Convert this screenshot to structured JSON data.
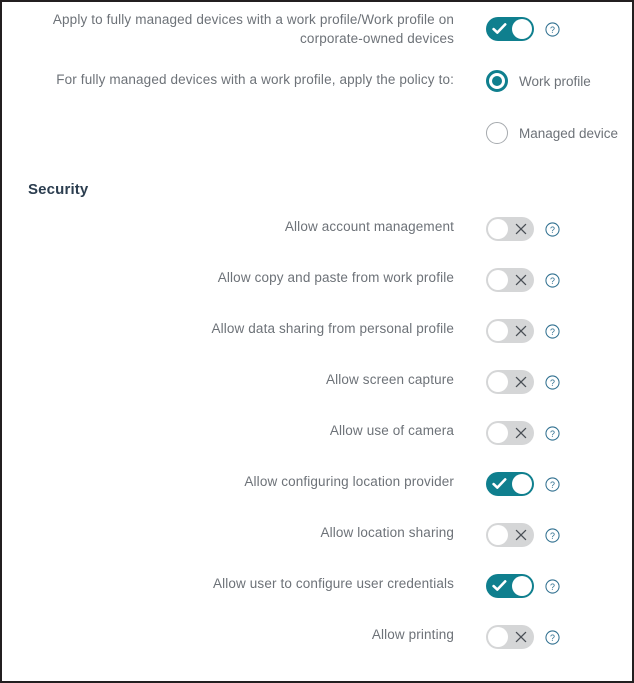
{
  "colors": {
    "accent": "#0f7f8e",
    "toggle_off_track": "#d5d6d7",
    "label_text": "#6d7278",
    "heading_text": "#2b3d4f",
    "border": "#231f20",
    "help_icon": "#2f6f8f",
    "x_mark": "#4a4f55"
  },
  "top_section": {
    "apply_row": {
      "label": "Apply to fully managed devices with a work profile/Work profile on corporate-owned devices",
      "toggle_state": "on",
      "help_tooltip_label": "help"
    },
    "policy_target_row": {
      "label": "For fully managed devices with a work profile, apply the policy to:",
      "options": [
        {
          "label": "Work profile",
          "selected": true
        },
        {
          "label": "Managed device",
          "selected": false
        }
      ]
    }
  },
  "security_section": {
    "heading": "Security",
    "settings": [
      {
        "label": "Allow account management",
        "toggle_state": "off"
      },
      {
        "label": "Allow copy and paste from work profile",
        "toggle_state": "off"
      },
      {
        "label": "Allow data sharing from personal profile",
        "toggle_state": "off"
      },
      {
        "label": "Allow screen capture",
        "toggle_state": "off"
      },
      {
        "label": "Allow use of camera",
        "toggle_state": "off"
      },
      {
        "label": "Allow configuring location provider",
        "toggle_state": "on"
      },
      {
        "label": "Allow location sharing",
        "toggle_state": "off"
      },
      {
        "label": "Allow user to configure user credentials",
        "toggle_state": "on"
      },
      {
        "label": "Allow printing",
        "toggle_state": "off"
      }
    ]
  }
}
